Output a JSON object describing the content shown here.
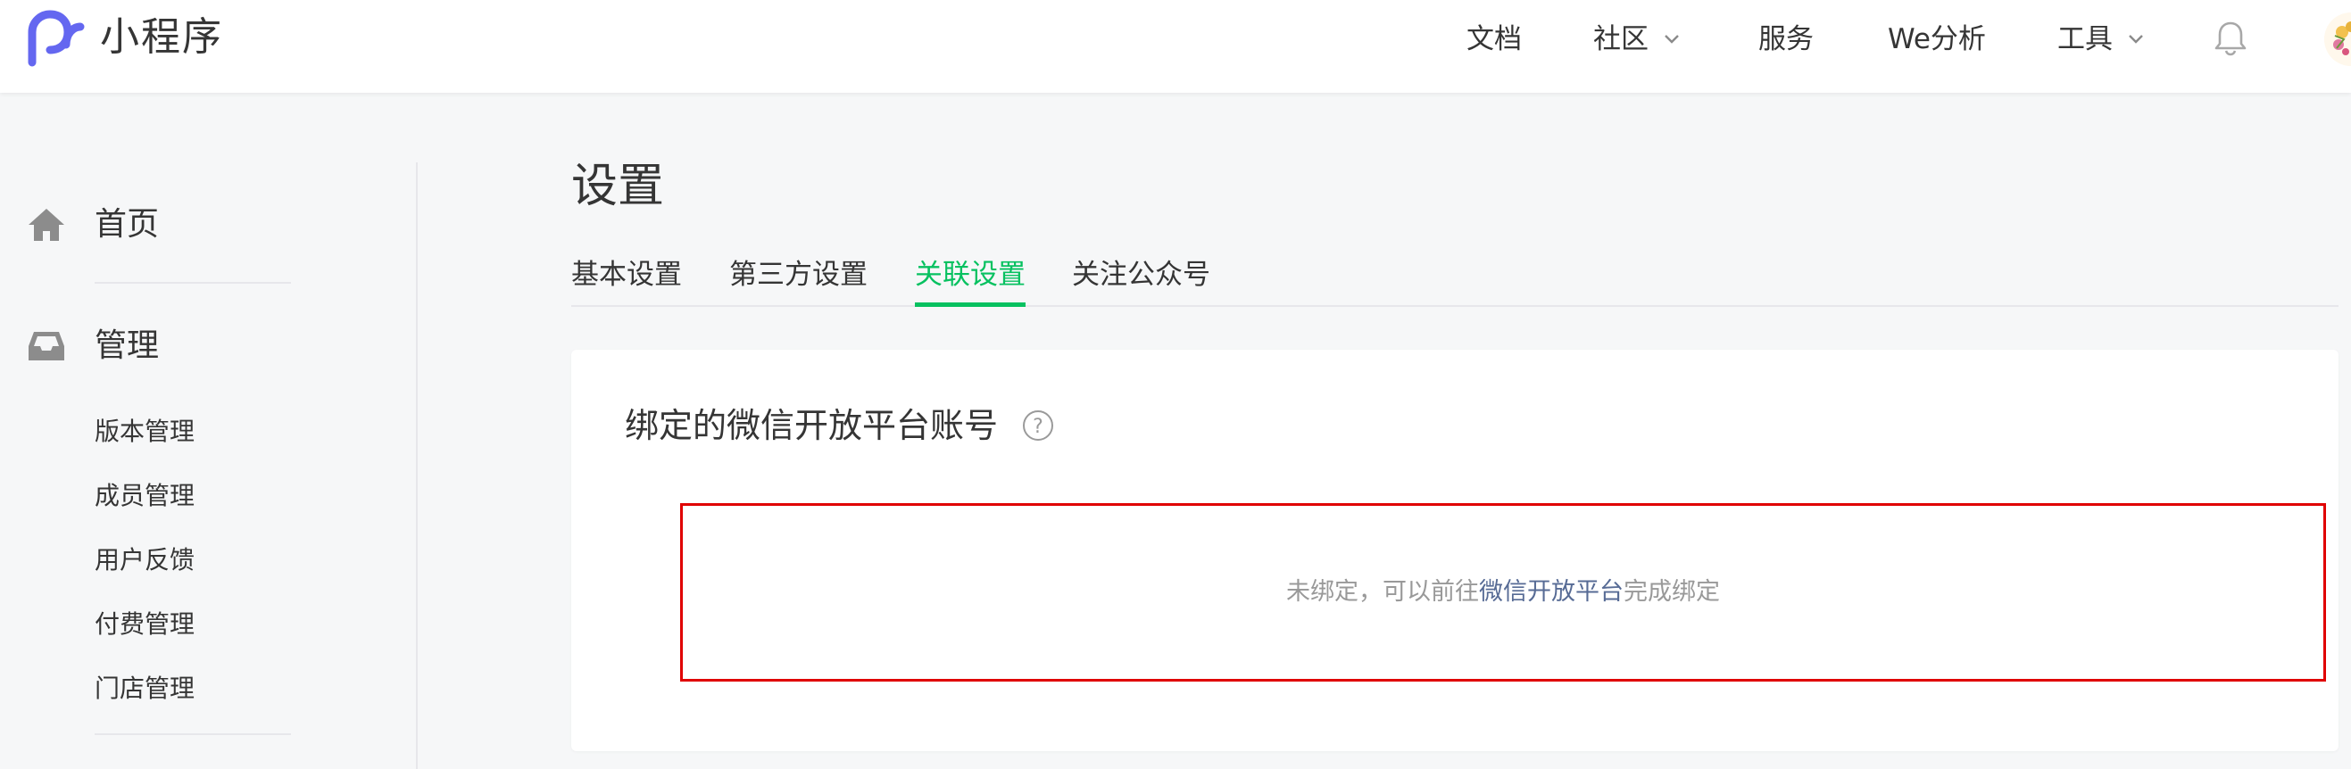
{
  "header": {
    "brand": "小程序",
    "nav": [
      {
        "label": "文档",
        "dropdown": false
      },
      {
        "label": "社区",
        "dropdown": true
      },
      {
        "label": "服务",
        "dropdown": false
      },
      {
        "label": "We分析",
        "dropdown": false
      },
      {
        "label": "工具",
        "dropdown": true
      }
    ],
    "icons": {
      "logo": "miniprogram-logo-icon",
      "bell": "bell-icon",
      "avatar": "user-avatar"
    }
  },
  "sidebar": {
    "home_label": "首页",
    "manage_label": "管理",
    "manage_items": [
      "版本管理",
      "成员管理",
      "用户反馈",
      "付费管理",
      "门店管理"
    ],
    "icons": {
      "home": "home-icon",
      "manage": "inbox-icon"
    }
  },
  "main": {
    "title": "设置",
    "tabs": [
      {
        "label": "基本设置",
        "active": false
      },
      {
        "label": "第三方设置",
        "active": false
      },
      {
        "label": "关联设置",
        "active": true
      },
      {
        "label": "关注公众号",
        "active": false
      }
    ],
    "card": {
      "title": "绑定的微信开放平台账号",
      "help_icon": "question-circle-icon",
      "bind_text_before": "未绑定，可以前往",
      "bind_link": "微信开放平台",
      "bind_text_after": "完成绑定"
    }
  },
  "colors": {
    "accent_green": "#07c160",
    "link_blue": "#576b95",
    "highlight_red": "#e00000",
    "logo_purple": "#6467f0",
    "background": "#f6f7f8"
  }
}
